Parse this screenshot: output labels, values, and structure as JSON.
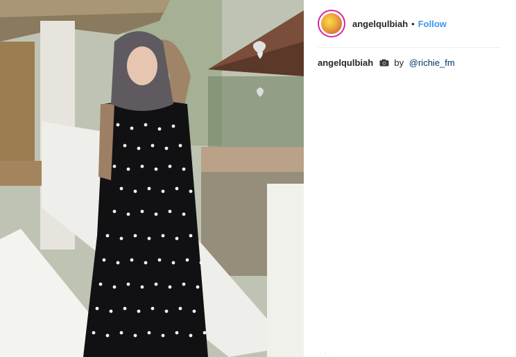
{
  "post": {
    "image": {
      "alt_icon": "photo-of-woman-in-polka-dot-dress"
    },
    "header": {
      "username": "angelqulbiah",
      "separator": "•",
      "follow_label": "Follow",
      "avatar_icon": "profile-avatar"
    },
    "caption": {
      "username": "angelqulbiah",
      "icon": "camera-icon",
      "text": "by",
      "mention": "@richie_fm"
    }
  },
  "colors": {
    "follow": "#3897f0",
    "mention": "#003569",
    "text": "#262626",
    "divider": "#efefef"
  }
}
